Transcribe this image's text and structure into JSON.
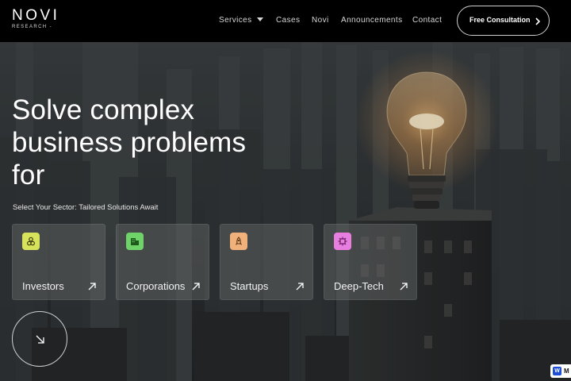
{
  "brand": {
    "name": "NOVI",
    "sub": "RESEARCH -"
  },
  "nav": {
    "items": [
      {
        "label": "Services"
      },
      {
        "label": "Cases"
      },
      {
        "label": "Novi"
      },
      {
        "label": "Announcements"
      },
      {
        "label": "Contact"
      }
    ],
    "cta_label": "Free Consultation"
  },
  "hero": {
    "headline_lines": [
      "Solve complex",
      "business problems",
      "for"
    ],
    "subline": "Select Your Sector: Tailored Solutions Await"
  },
  "sectors": [
    {
      "label": "Investors",
      "icon": "investors-icon",
      "color": "#d7e35a"
    },
    {
      "label": "Corporations",
      "icon": "building-icon",
      "color": "#6fd36a"
    },
    {
      "label": "Startups",
      "icon": "rocket-icon",
      "color": "#f0b27a"
    },
    {
      "label": "Deep-Tech",
      "icon": "chip-icon",
      "color": "#e77ee0"
    }
  ],
  "badge": {
    "text": "M"
  }
}
